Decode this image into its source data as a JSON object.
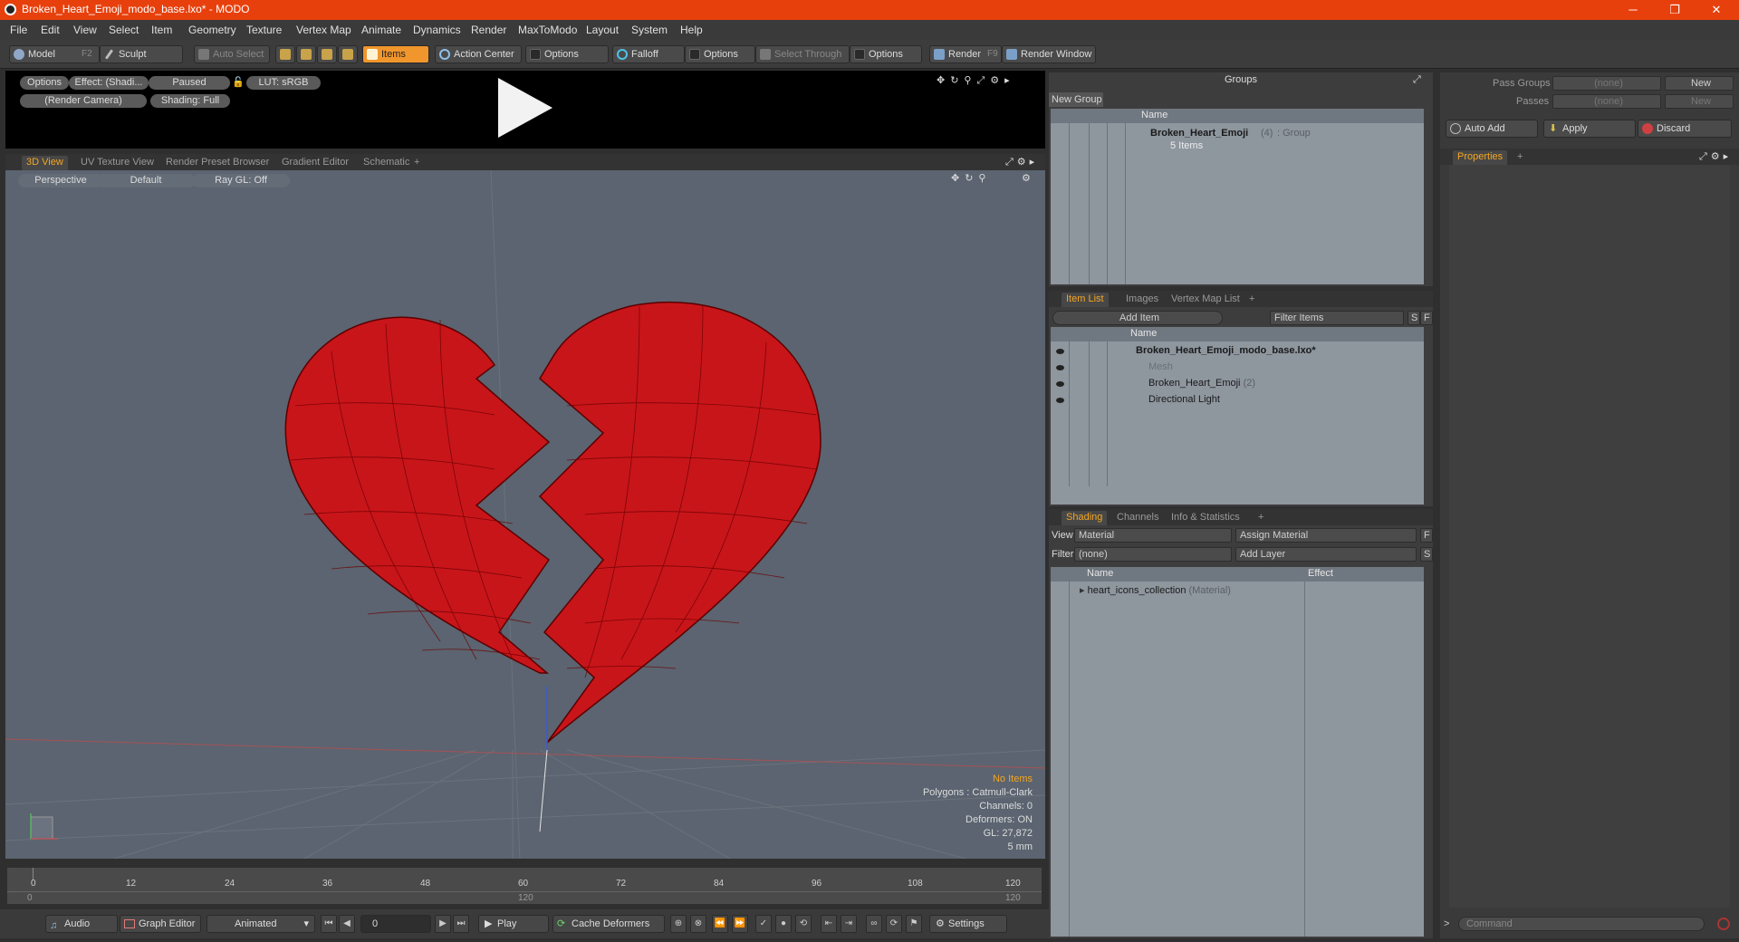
{
  "window": {
    "title": "Broken_Heart_Emoji_modo_base.lxo* - MODO",
    "minimize": "─",
    "restore": "❐",
    "close": "✕"
  },
  "menu": [
    "File",
    "Edit",
    "View",
    "Select",
    "Item",
    "Geometry",
    "Texture",
    "Vertex Map",
    "Animate",
    "Dynamics",
    "Render",
    "MaxToModo",
    "Layout",
    "System",
    "Help"
  ],
  "toolbar": {
    "model": "Model",
    "model_key": "F2",
    "sculpt": "Sculpt",
    "auto_select": "Auto Select",
    "items": "Items",
    "action_center": "Action Center",
    "options1": "Options",
    "falloff": "Falloff",
    "options2": "Options",
    "select_through": "Select Through",
    "options3": "Options",
    "render": "Render",
    "render_key": "F9",
    "render_window": "Render Window"
  },
  "preview": {
    "options": "Options",
    "effect": "Effect: (Shadi...",
    "paused": "Paused",
    "lut": "LUT: sRGB",
    "camera": "(Render Camera)",
    "shading": "Shading: Full"
  },
  "viewport_tabs": [
    "3D View",
    "UV Texture View",
    "Render Preset Browser",
    "Gradient Editor",
    "Schematic",
    "+"
  ],
  "viewport": {
    "perspective": "Perspective",
    "default": "Default",
    "raygl": "Ray GL: Off",
    "hud": {
      "no_items": "No Items",
      "polygons": "Polygons : Catmull-Clark",
      "channels": "Channels: 0",
      "deformers": "Deformers: ON",
      "gl": "GL: 27,872",
      "scale": "5 mm"
    },
    "colors": {
      "heart": "#c8151a",
      "bg": "#5b6470"
    }
  },
  "timeline": {
    "ticks": [
      "0",
      "12",
      "24",
      "36",
      "48",
      "60",
      "72",
      "84",
      "96",
      "108",
      "120"
    ],
    "sub_left": "0",
    "sub_mid": "120",
    "sub_right": "120"
  },
  "bottombar": {
    "audio": "Audio",
    "graph_editor": "Graph Editor",
    "animated": "Animated",
    "frame": "0",
    "play": "Play",
    "cache_deformers": "Cache Deformers",
    "settings": "Settings"
  },
  "groups": {
    "title": "Groups",
    "new_group": "New Group",
    "col_name": "Name",
    "item_name": "Broken_Heart_Emoji",
    "item_count": "(4)",
    "item_type": ": Group",
    "item_sub": "5 Items"
  },
  "passes": {
    "pass_groups": "Pass Groups",
    "passes": "Passes",
    "pass_value": "(none)",
    "passes_value": "(none)",
    "new1": "New",
    "new2": "New"
  },
  "actions": {
    "auto_add": "Auto Add",
    "apply": "Apply",
    "discard": "Discard"
  },
  "properties_tab": "Properties",
  "itemlist": {
    "tabs": [
      "Item List",
      "Images",
      "Vertex Map List",
      "+"
    ],
    "add_item": "Add Item",
    "filter": "Filter Items",
    "s": "S",
    "f": "F",
    "col_name": "Name",
    "rows": [
      {
        "name": "Broken_Heart_Emoji_modo_base.lxo*",
        "extra": ""
      },
      {
        "name": "Mesh",
        "extra": ""
      },
      {
        "name": "Broken_Heart_Emoji",
        "extra": "(2)"
      },
      {
        "name": "Directional Light",
        "extra": ""
      }
    ]
  },
  "shading": {
    "tabs": [
      "Shading",
      "Channels",
      "Info & Statistics",
      "+"
    ],
    "view_label": "View",
    "view_value": "Material",
    "assign": "Assign Material",
    "f": "F",
    "filter_label": "Filter",
    "filter_value": "(none)",
    "add_layer": "Add Layer",
    "s": "S",
    "col_name": "Name",
    "col_effect": "Effect",
    "row_name": "heart_icons_collection",
    "row_type": "(Material)"
  },
  "command": {
    "prompt": ">",
    "placeholder": "Command"
  }
}
